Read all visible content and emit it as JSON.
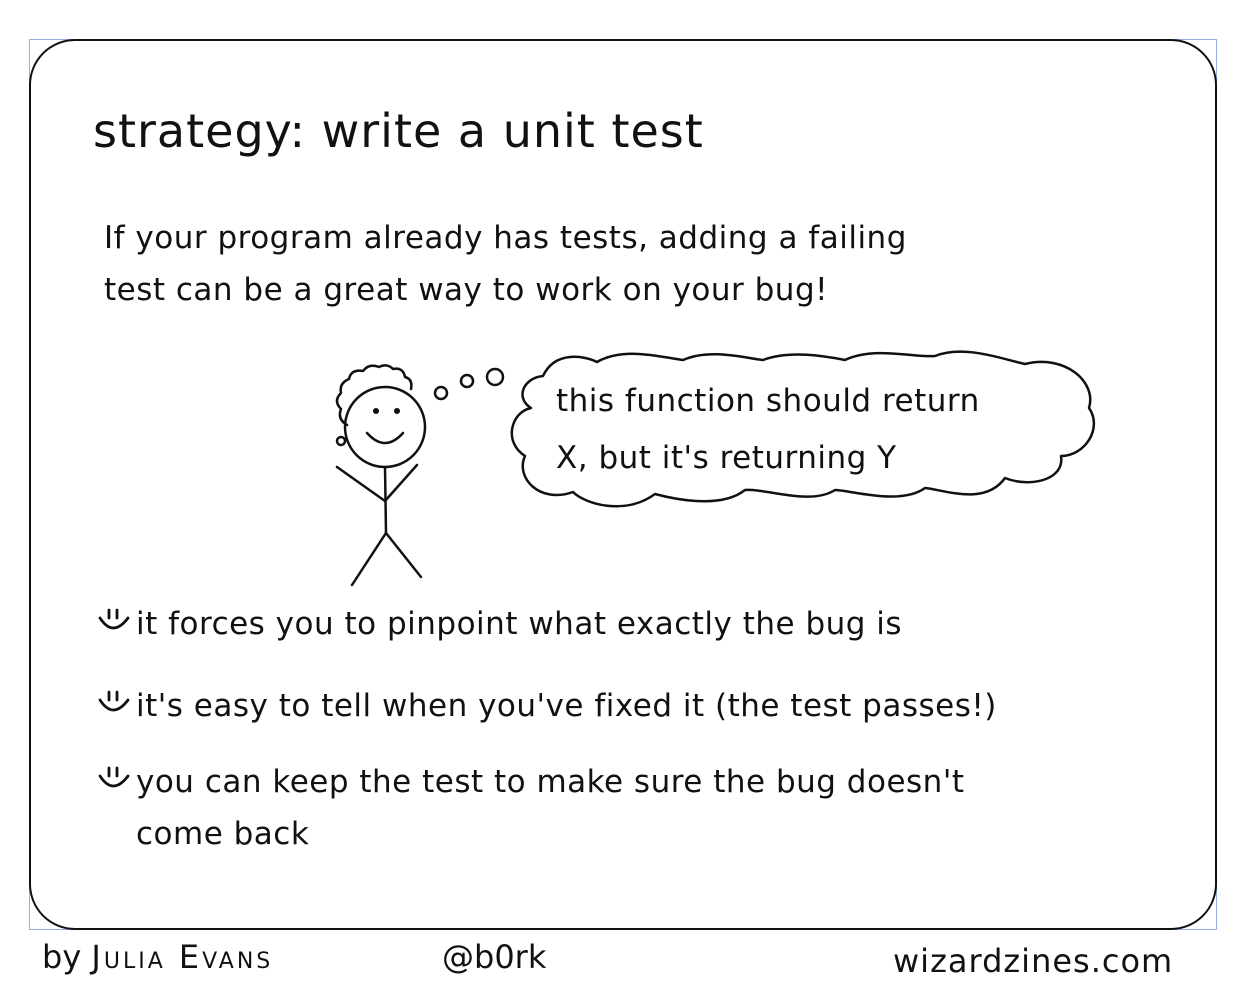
{
  "title": "strategy: write a unit test",
  "intro": {
    "line1": "If your program already has tests, adding a failing",
    "line2": "test can be a great way to work on your bug!"
  },
  "thought": {
    "line1": "this function should return",
    "line2": "X, but it's returning Y"
  },
  "bullets": [
    {
      "icon": "smiley-icon",
      "lines": [
        "it forces you to pinpoint what exactly the bug is"
      ]
    },
    {
      "icon": "smiley-icon",
      "lines": [
        "it's easy to tell when you've fixed it (the test passes!)"
      ]
    },
    {
      "icon": "smiley-icon",
      "lines": [
        "you can keep the test to make sure the bug doesn't",
        "come back"
      ]
    }
  ],
  "footer": {
    "by": "by",
    "author": "Julia Evans",
    "handle": "@b0rk",
    "site": "wizardzines.com"
  }
}
